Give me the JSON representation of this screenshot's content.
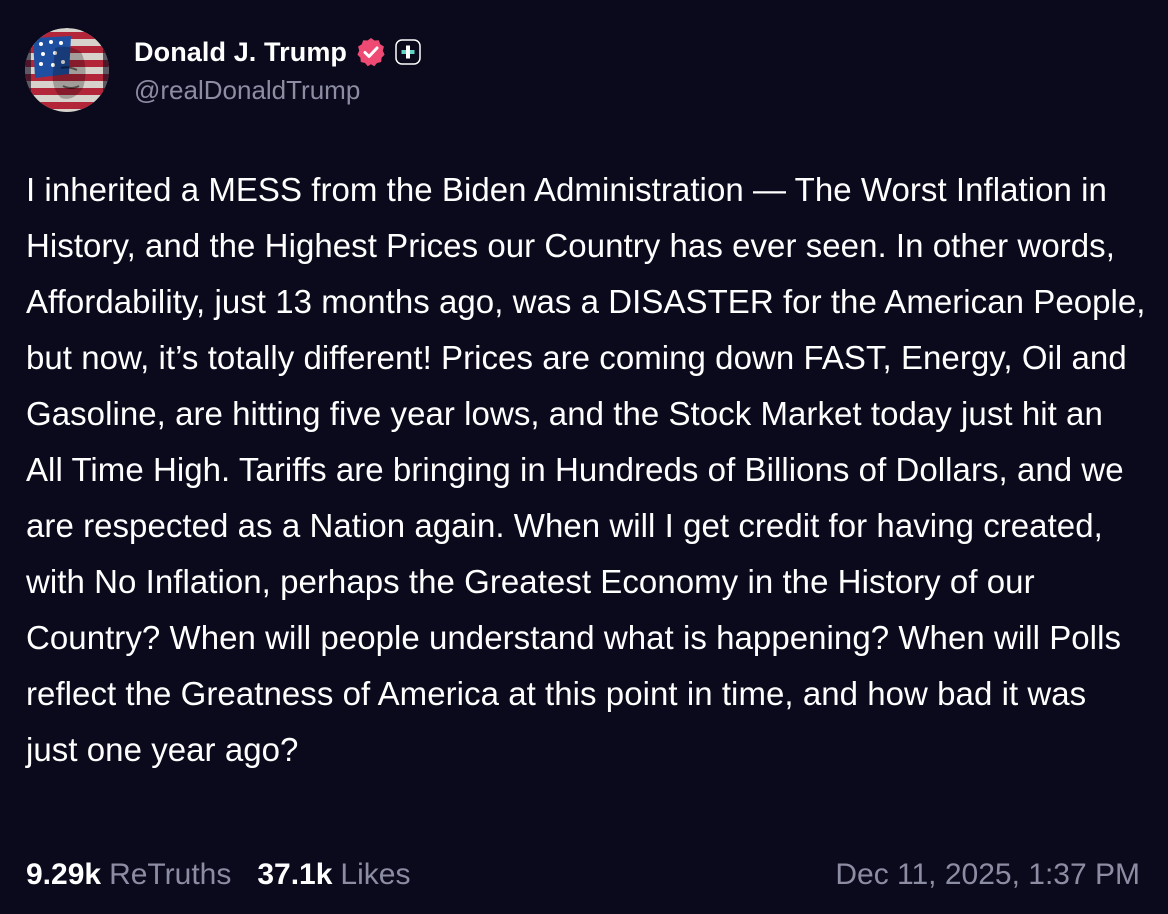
{
  "author": {
    "display_name": "Donald J. Trump",
    "handle": "@realDonaldTrump",
    "verified_icon": "verified-badge-icon",
    "verified_color": "#ee4a73",
    "plus_icon": "plus-badge-icon"
  },
  "post": {
    "text": "I inherited a MESS from the Biden Administration — The Worst Inflation in History, and the Highest Prices our Country has ever seen. In other words, Affordability, just 13 months ago, was a DISASTER for the American People, but now, it’s totally different! Prices are coming down FAST, Energy, Oil and Gasoline, are hitting five year lows, and the Stock Market today just hit an All Time High. Tariffs are bringing in Hundreds of Billions of Dollars, and we are respected as a Nation again. When will I get credit for having created, with No Inflation, perhaps the Greatest Economy in the History of our Country? When will people understand what is happening? When will Polls reflect the Greatness of America at this point in time, and how bad it was just one year ago?"
  },
  "stats": {
    "retruths_count": "9.29k",
    "retruths_label": "ReTruths",
    "likes_count": "37.1k",
    "likes_label": "Likes"
  },
  "timestamp": "Dec 11, 2025, 1:37 PM",
  "colors": {
    "background": "#0b0a1c",
    "text": "#ffffff",
    "muted": "#8c8ca3",
    "accent": "#ee4a73"
  }
}
